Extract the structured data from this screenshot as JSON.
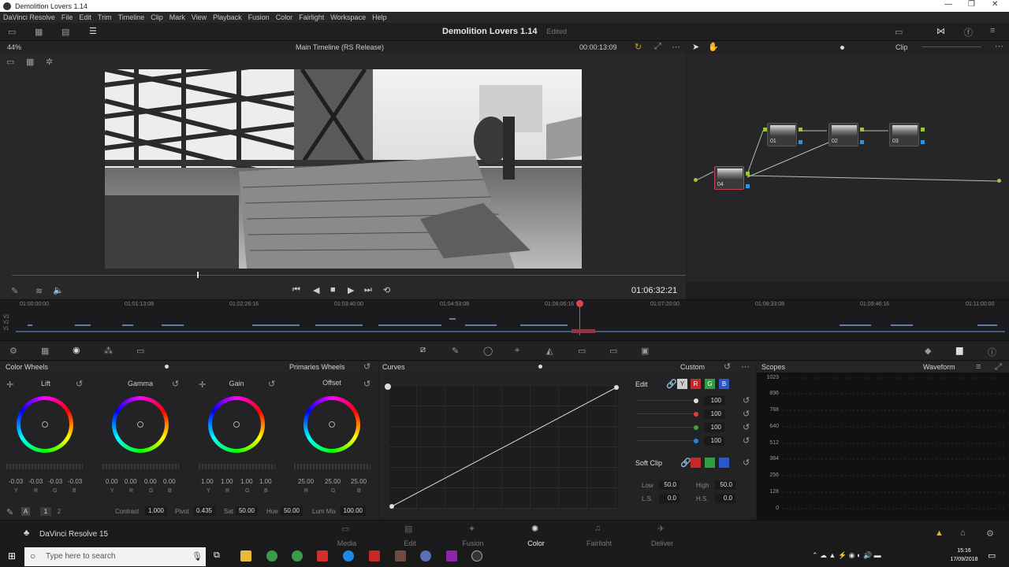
{
  "window": {
    "title": "Demolition Lovers 1.14",
    "controls": [
      "—",
      "❐",
      "✕"
    ]
  },
  "menu": [
    "DaVinci Resolve",
    "File",
    "Edit",
    "Trim",
    "Timeline",
    "Clip",
    "Mark",
    "View",
    "Playback",
    "Fusion",
    "Color",
    "Fairlight",
    "Workspace",
    "Help"
  ],
  "project": {
    "name": "Demolition Lovers 1.14",
    "status": "Edited"
  },
  "viewer": {
    "zoom": "44%",
    "timeline_name": "Main Timeline (RS Release)",
    "duration": "00:00:13:09",
    "timecode": "01:06:32:21"
  },
  "node_editor": {
    "mode": "Clip",
    "nodes": [
      "01",
      "02",
      "03",
      "04"
    ]
  },
  "timeline": {
    "ruler": [
      "01:00:00:00",
      "01:01:13:08",
      "01:02:26:16",
      "01:03:40:00",
      "01:04:53:08",
      "01:06:06:16",
      "01:07:20:00",
      "01:08:33:08",
      "01:09:46:16",
      "01:11:00:00"
    ],
    "tracks": [
      "V3",
      "V2",
      "V1"
    ]
  },
  "color_wheels": {
    "title": "Color Wheels",
    "mode": "Primaries Wheels",
    "wheels": [
      {
        "name": "Lift",
        "values": [
          "-0.03",
          "-0.03",
          "-0.03",
          "-0.03"
        ]
      },
      {
        "name": "Gamma",
        "values": [
          "0.00",
          "0.00",
          "0.00",
          "0.00"
        ]
      },
      {
        "name": "Gain",
        "values": [
          "1.00",
          "1.00",
          "1.00",
          "1.00"
        ]
      },
      {
        "name": "Offset",
        "values": [
          "25.00",
          "25.00",
          "25.00"
        ]
      }
    ],
    "channels4": [
      "Y",
      "R",
      "G",
      "B"
    ],
    "channels3": [
      "R",
      "G",
      "B"
    ],
    "pages": [
      "1",
      "2"
    ],
    "contrast_label": "Contrast",
    "contrast": "1.000",
    "pivot_label": "Pivot",
    "pivot": "0.435",
    "sat_label": "Sat",
    "sat": "50.00",
    "hue_label": "Hue",
    "hue": "50.00",
    "lummix_label": "Lum Mix",
    "lummix": "100.00"
  },
  "curves": {
    "title": "Curves",
    "mode": "Custom",
    "edit_label": "Edit",
    "edit_channels": [
      "Y",
      "R",
      "G",
      "B"
    ],
    "edit_values": [
      "100",
      "100",
      "100",
      "100"
    ],
    "soft_clip": {
      "label": "Soft Clip",
      "low_label": "Low",
      "low": "50.0",
      "high_label": "High",
      "high": "50.0",
      "ls_label": "L.S.",
      "ls": "0.0",
      "hs_label": "H.S.",
      "hs": "0.0"
    }
  },
  "scopes": {
    "title": "Scopes",
    "mode": "Waveform",
    "scale": [
      "1023",
      "896",
      "768",
      "640",
      "512",
      "384",
      "256",
      "128",
      "0"
    ]
  },
  "pages": [
    "Media",
    "Edit",
    "Fusion",
    "Color",
    "Fairlight",
    "Deliver"
  ],
  "active_page": "Color",
  "app_badge": "DaVinci Resolve 15",
  "taskbar": {
    "search_placeholder": "Type here to search",
    "time": "15:16",
    "date": "17/09/2018"
  },
  "colors": {
    "accent": "#e0454e",
    "track": "#5c7ea8",
    "node_link": "#9bc53d",
    "node_out": "#3a8fe0"
  }
}
